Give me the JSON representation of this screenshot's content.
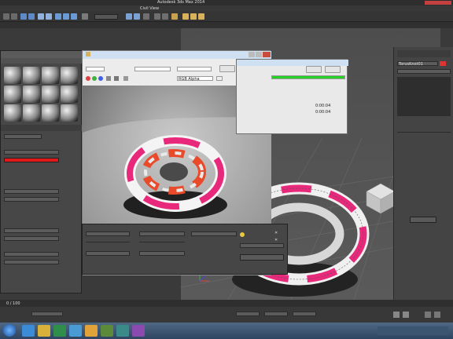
{
  "app": {
    "title": "Autodesk 3ds Max 2014",
    "right_title": ""
  },
  "menubar": {
    "items": [
      "",
      "",
      "",
      "",
      "",
      "Civil View",
      "",
      "",
      ""
    ]
  },
  "render_window": {
    "title": "",
    "toolbar_labels": [
      "",
      "",
      ""
    ],
    "dropdowns": [
      "",
      "",
      "",
      "",
      ""
    ],
    "channel_select": "RGB Alpha"
  },
  "progress_dialog": {
    "title": "",
    "buttons": [
      "",
      ""
    ],
    "section_label": "",
    "stats": [
      {
        "label": "",
        "value": "0:00:04"
      },
      {
        "label": "",
        "value": "0:00:04"
      },
      {
        "label": "",
        "value": ""
      }
    ],
    "progress_fraction": 1.0
  },
  "material_editor": {
    "title": "",
    "slot_name": "",
    "map_label": "",
    "sections": [
      "",
      "",
      "",
      "",
      "",
      ""
    ]
  },
  "render_settings": {
    "labels": [
      "",
      "",
      "",
      "",
      "",
      "",
      "",
      "",
      "",
      "",
      "",
      "",
      "",
      "",
      "",
      ""
    ],
    "render_button": ""
  },
  "command_panel": {
    "object_name": "TorusKnot01",
    "modifier_list": "",
    "stack": [
      "",
      "",
      "",
      "",
      ""
    ],
    "sections": [
      "",
      "",
      "",
      "",
      "",
      "",
      "",
      "",
      "",
      "",
      "",
      "",
      "",
      "",
      ""
    ]
  },
  "timeline": {
    "frame_label": "0 / 100"
  },
  "statusbar": {
    "fields": [
      "",
      "",
      "",
      "",
      ""
    ]
  },
  "colors": {
    "accent_red": "#e01818",
    "knot_pink": "#e8287a",
    "progress_green": "#27d127"
  }
}
